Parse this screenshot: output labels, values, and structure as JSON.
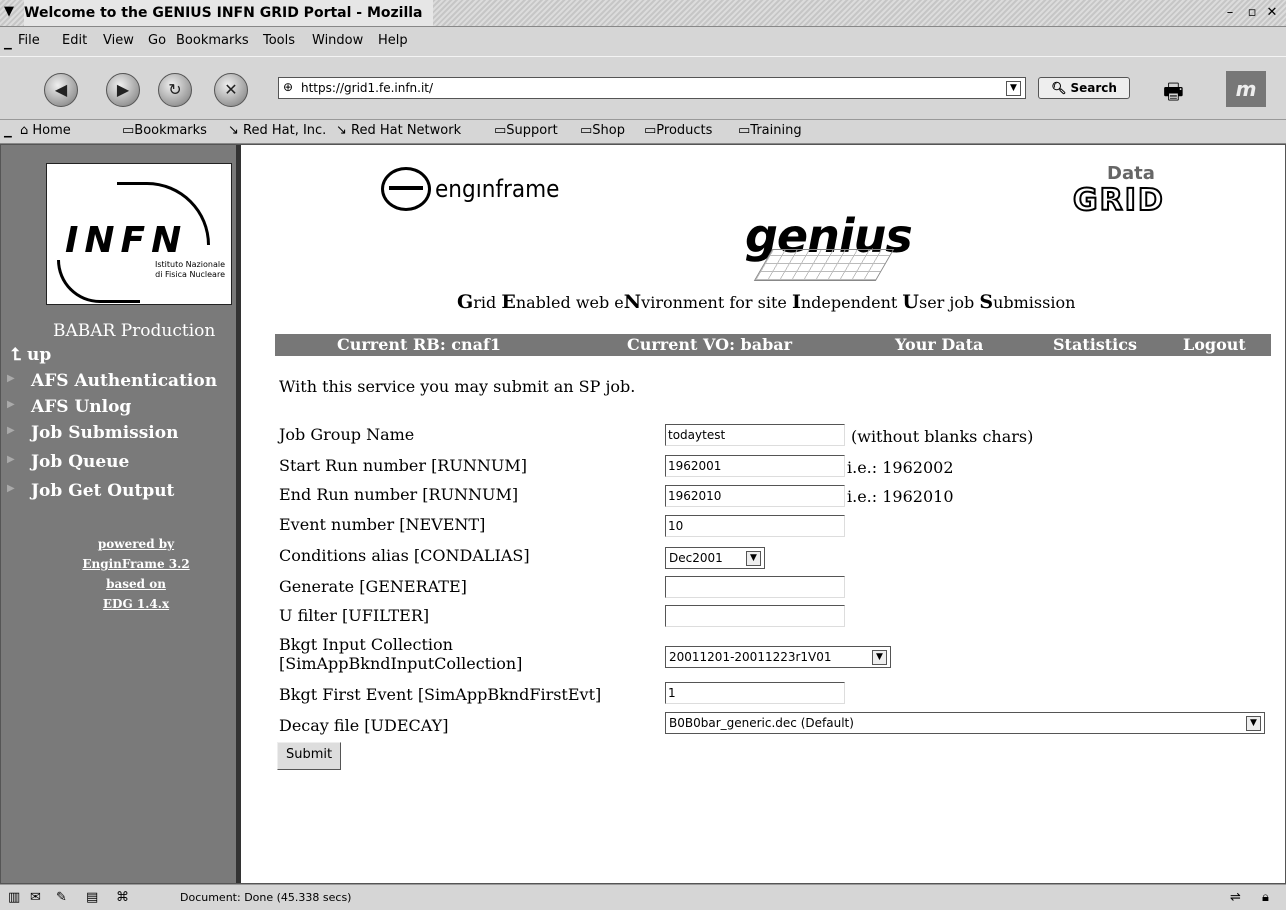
{
  "window": {
    "title": "Welcome to the GENIUS INFN GRID Portal - Mozilla",
    "controls": {
      "minimize": "–",
      "maximize": "▫",
      "close": "✕"
    }
  },
  "menu": [
    "File",
    "Edit",
    "View",
    "Go",
    "Bookmarks",
    "Tools",
    "Window",
    "Help"
  ],
  "toolbar": {
    "url": "https://grid1.fe.infn.it/",
    "search_label": "Search",
    "back_icon": "back-arrow-icon",
    "forward_icon": "forward-arrow-icon",
    "reload_icon": "reload-icon",
    "stop_icon": "stop-icon"
  },
  "bookmarks": {
    "home": "Home",
    "items": [
      "Bookmarks",
      "Red Hat, Inc.",
      "Red Hat Network",
      "Support",
      "Shop",
      "Products",
      "Training"
    ]
  },
  "sidebar": {
    "logo_text": "INFN",
    "logo_sub1": "Istituto Nazionale",
    "logo_sub2": "di Fisica Nucleare",
    "title": "BABAR Production",
    "up": "up",
    "items": [
      "AFS Authentication",
      "AFS Unlog",
      "Job Submission",
      "Job Queue",
      "Job Get Output"
    ],
    "footer": [
      "powered by",
      "EnginFrame 3.2",
      "based on",
      "EDG 1.4.x"
    ]
  },
  "header": {
    "enginframe": "engınframe",
    "genius": "genius",
    "datagrid_top": "Data",
    "datagrid_bottom": "GRID",
    "tagline": {
      "p1b": "G",
      "p1": "rid ",
      "p2b": "E",
      "p2": "nabled web e",
      "p3b": "N",
      "p3": "vironment for site ",
      "p4b": "I",
      "p4": "ndependent ",
      "p5b": "U",
      "p5": "ser job ",
      "p6b": "S",
      "p6": "ubmission"
    }
  },
  "navstrip": {
    "rb": "Current RB: cnaf1",
    "vo": "Current VO: babar",
    "data": "Your Data",
    "stats": "Statistics",
    "logout": "Logout"
  },
  "form": {
    "intro": "With this service you may submit an SP job.",
    "job_group_label": "Job Group Name",
    "job_group_value": "todaytest",
    "job_group_hint": "(without blanks chars)",
    "start_run_label": "Start Run number [RUNNUM]",
    "start_run_value": "1962001",
    "start_run_hint": "i.e.: 1962002",
    "end_run_label": "End Run number [RUNNUM]",
    "end_run_value": "1962010",
    "end_run_hint": "i.e.: 1962010",
    "event_label": "Event number [NEVENT]",
    "event_value": "10",
    "cond_label": "Conditions alias [CONDALIAS]",
    "cond_value": "Dec2001",
    "generate_label": "Generate [GENERATE]",
    "generate_value": "",
    "ufilter_label": "U filter [UFILTER]",
    "ufilter_value": "",
    "bkgt_label1": "Bkgt Input Collection",
    "bkgt_label2": "[SimAppBkndInputCollection]",
    "bkgt_value": "20011201-20011223r1V01",
    "bkgt_first_label": "Bkgt First Event [SimAppBkndFirstEvt]",
    "bkgt_first_value": "1",
    "decay_label": "Decay file [UDECAY]",
    "decay_value": "B0B0bar_generic.dec (Default)",
    "submit_label": "Submit"
  },
  "status": {
    "text": "Document: Done (45.338 secs)"
  }
}
